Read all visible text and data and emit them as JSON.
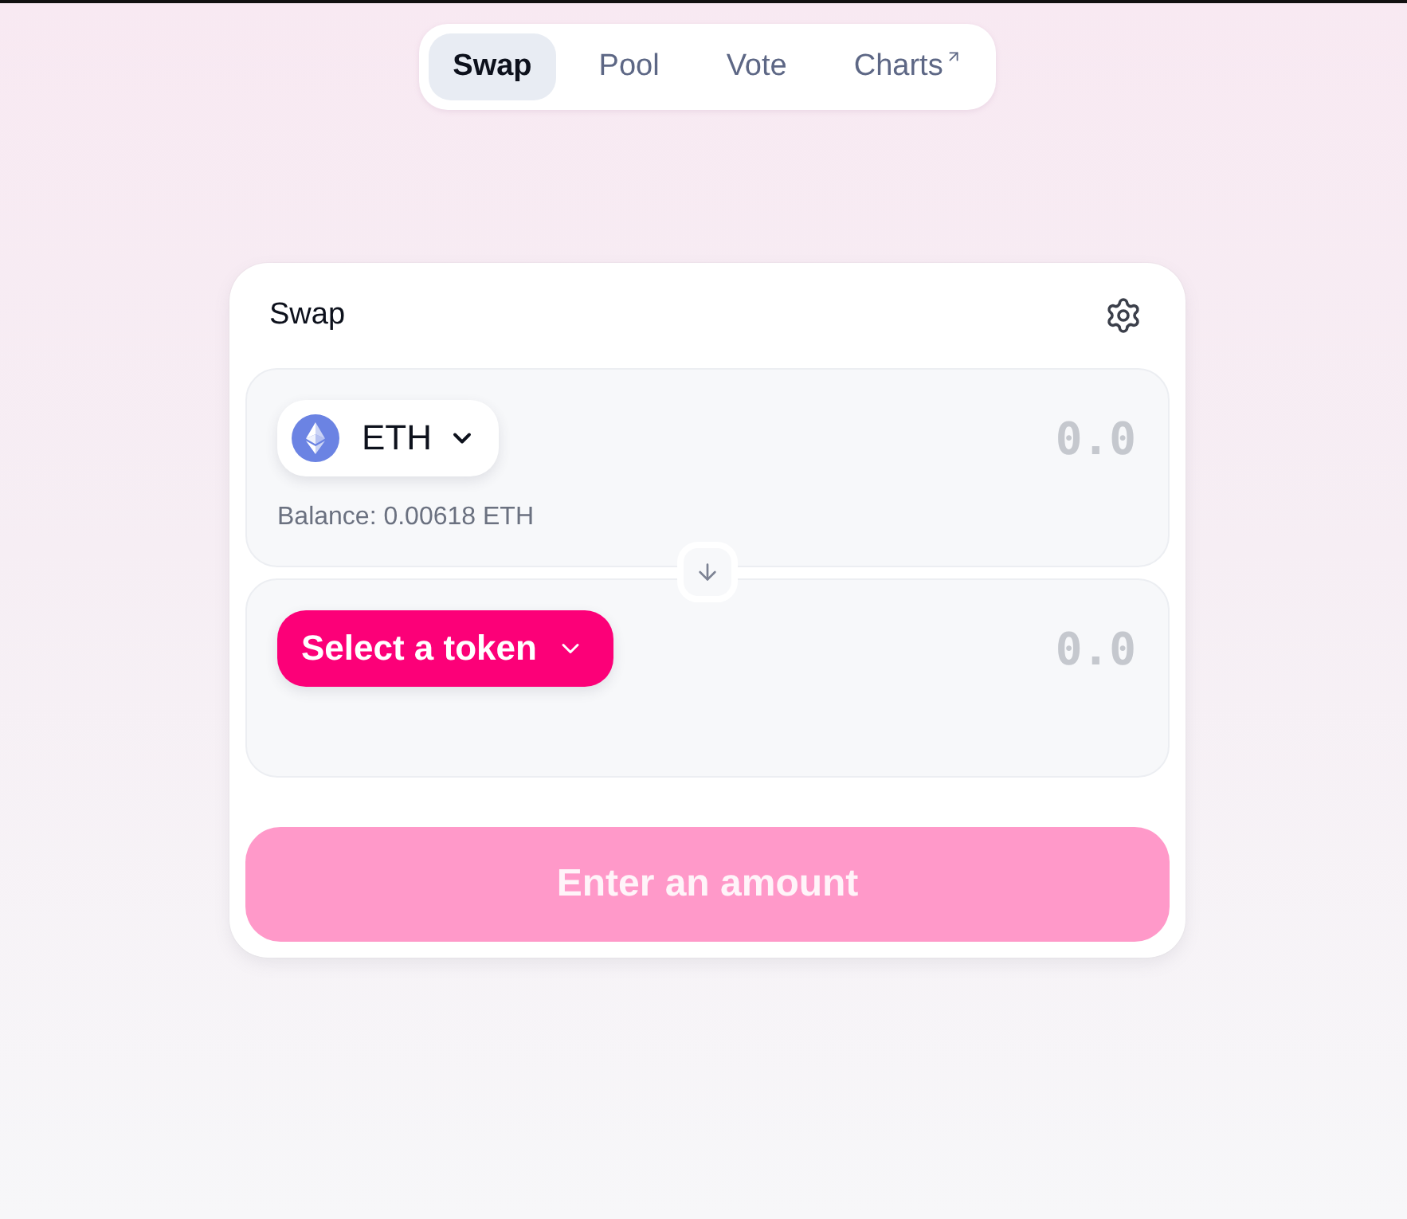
{
  "nav": {
    "tabs": [
      {
        "label": "Swap",
        "selected": true,
        "external": false
      },
      {
        "label": "Pool",
        "selected": false,
        "external": false
      },
      {
        "label": "Vote",
        "selected": false,
        "external": false
      },
      {
        "label": "Charts",
        "selected": false,
        "external": true
      }
    ]
  },
  "card": {
    "title": "Swap"
  },
  "panels": [
    {
      "kind": "token",
      "token": "ETH",
      "placeholder": "0.0",
      "balance": "Balance: 0.00618 ETH"
    },
    {
      "kind": "select",
      "token": "Select a token",
      "placeholder": "0.0"
    }
  ],
  "submit": {
    "label": "Enter an amount",
    "disabled": true
  }
}
